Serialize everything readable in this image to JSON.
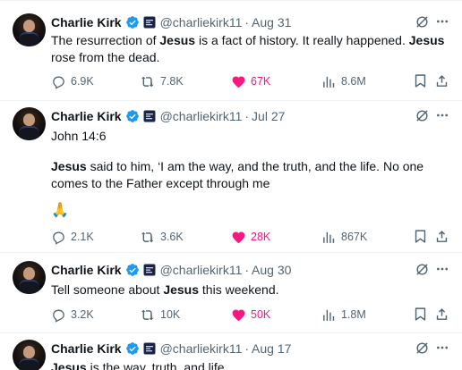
{
  "tweets": [
    {
      "author_name": "Charlie Kirk",
      "handle": "@charliekirk11",
      "separator": "·",
      "date": "Aug 31",
      "segments": [
        {
          "t": "The resurrection of ",
          "b": false
        },
        {
          "t": "Jesus",
          "b": true
        },
        {
          "t": " is a fact of history. It really happened. ",
          "b": false
        },
        {
          "t": "Jesus",
          "b": true
        },
        {
          "t": " rose from the dead.",
          "b": false
        }
      ],
      "replies": "6.9K",
      "reposts": "7.8K",
      "likes": "67K",
      "views": "8.6M"
    },
    {
      "author_name": "Charlie Kirk",
      "handle": "@charliekirk11",
      "separator": "·",
      "date": "Jul 27",
      "line1": "John 14:6",
      "segments": [
        {
          "t": "Jesus",
          "b": true
        },
        {
          "t": " said to him, ‘I am the way, and the truth, and the life. No one comes to the Father except through me",
          "b": false
        }
      ],
      "emoji": "🙏",
      "replies": "2.1K",
      "reposts": "3.6K",
      "likes": "28K",
      "views": "867K"
    },
    {
      "author_name": "Charlie Kirk",
      "handle": "@charliekirk11",
      "separator": "·",
      "date": "Aug 30",
      "segments": [
        {
          "t": "Tell someone about ",
          "b": false
        },
        {
          "t": "Jesus",
          "b": true
        },
        {
          "t": " this weekend.",
          "b": false
        }
      ],
      "replies": "3.2K",
      "reposts": "10K",
      "likes": "50K",
      "views": "1.8M"
    },
    {
      "author_name": "Charlie Kirk",
      "handle": "@charliekirk11",
      "separator": "·",
      "date": "Aug 17",
      "segments": [
        {
          "t": "Jesus",
          "b": true
        },
        {
          "t": " is the way, truth, and life",
          "b": false
        }
      ]
    }
  ],
  "colors": {
    "verified": "#1d9bf0",
    "like_active": "#f91880",
    "muted": "#536471",
    "text": "#0f1419"
  },
  "icons": [
    "verified-badge-icon",
    "affiliate-badge-icon",
    "grok-icon",
    "more-icon",
    "reply-icon",
    "repost-icon",
    "heart-icon",
    "views-icon",
    "bookmark-icon",
    "share-icon"
  ]
}
